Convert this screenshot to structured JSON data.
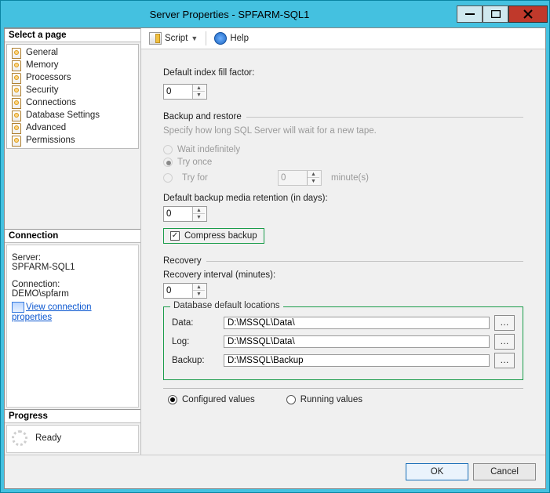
{
  "window": {
    "title": "Server Properties - SPFARM-SQL1"
  },
  "sidebar": {
    "select_page": "Select a page",
    "pages": [
      "General",
      "Memory",
      "Processors",
      "Security",
      "Connections",
      "Database Settings",
      "Advanced",
      "Permissions"
    ],
    "connection_head": "Connection",
    "server_label": "Server:",
    "server_val": "SPFARM-SQL1",
    "conn_label": "Connection:",
    "conn_val": "DEMO\\spfarm",
    "view_conn": "View connection properties",
    "progress_head": "Progress",
    "progress_val": "Ready"
  },
  "toolbar": {
    "script": "Script",
    "help": "Help"
  },
  "main": {
    "fill_label": "Default index fill factor:",
    "fill_value": "0",
    "backup_restore": "Backup and restore",
    "br_hint": "Specify how long SQL Server will wait for a new tape.",
    "wait_indef": "Wait indefinitely",
    "try_once": "Try once",
    "try_for": "Try for",
    "try_for_val": "0",
    "minutes": "minute(s)",
    "retention_label": "Default backup media retention (in days):",
    "retention_val": "0",
    "compress_label": "Compress backup",
    "recovery_head": "Recovery",
    "recovery_interval_label": "Recovery interval (minutes):",
    "recovery_interval_val": "0",
    "dbloc_legend": "Database default locations",
    "data_label": "Data:",
    "data_path": "D:\\MSSQL\\Data\\",
    "log_label": "Log:",
    "log_path": "D:\\MSSQL\\Data\\",
    "backup_label": "Backup:",
    "backup_path": "D:\\MSSQL\\Backup",
    "configured": "Configured values",
    "running": "Running values"
  },
  "footer": {
    "ok": "OK",
    "cancel": "Cancel"
  }
}
